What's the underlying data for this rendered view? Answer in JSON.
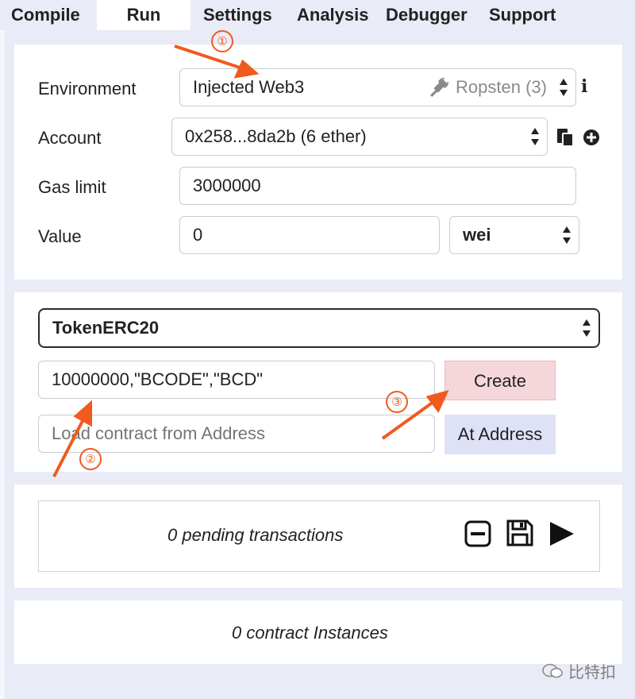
{
  "tabs": [
    {
      "label": "Compile"
    },
    {
      "label": "Run"
    },
    {
      "label": "Settings"
    },
    {
      "label": "Analysis"
    },
    {
      "label": "Debugger"
    },
    {
      "label": "Support"
    }
  ],
  "settings": {
    "environment_label": "Environment",
    "environment_value": "Injected Web3",
    "network_note": "Ropsten (3)",
    "account_label": "Account",
    "account_value": "0x258...8da2b (6 ether)",
    "gas_label": "Gas limit",
    "gas_value": "3000000",
    "value_label": "Value",
    "value_value": "0",
    "unit_value": "wei"
  },
  "deploy": {
    "contract_selected": "TokenERC20",
    "constructor_args": "10000000,\"BCODE\",\"BCD\"",
    "create_label": "Create",
    "address_placeholder": "Load contract from Address",
    "at_address_label": "At Address"
  },
  "transactions": {
    "pending_text": "0 pending transactions"
  },
  "instances": {
    "text": "0 contract Instances"
  },
  "annotations": {
    "n1": "①",
    "n2": "②",
    "n3": "③",
    "color": "#f05a1f"
  },
  "watermark": {
    "text": "比特扣"
  }
}
